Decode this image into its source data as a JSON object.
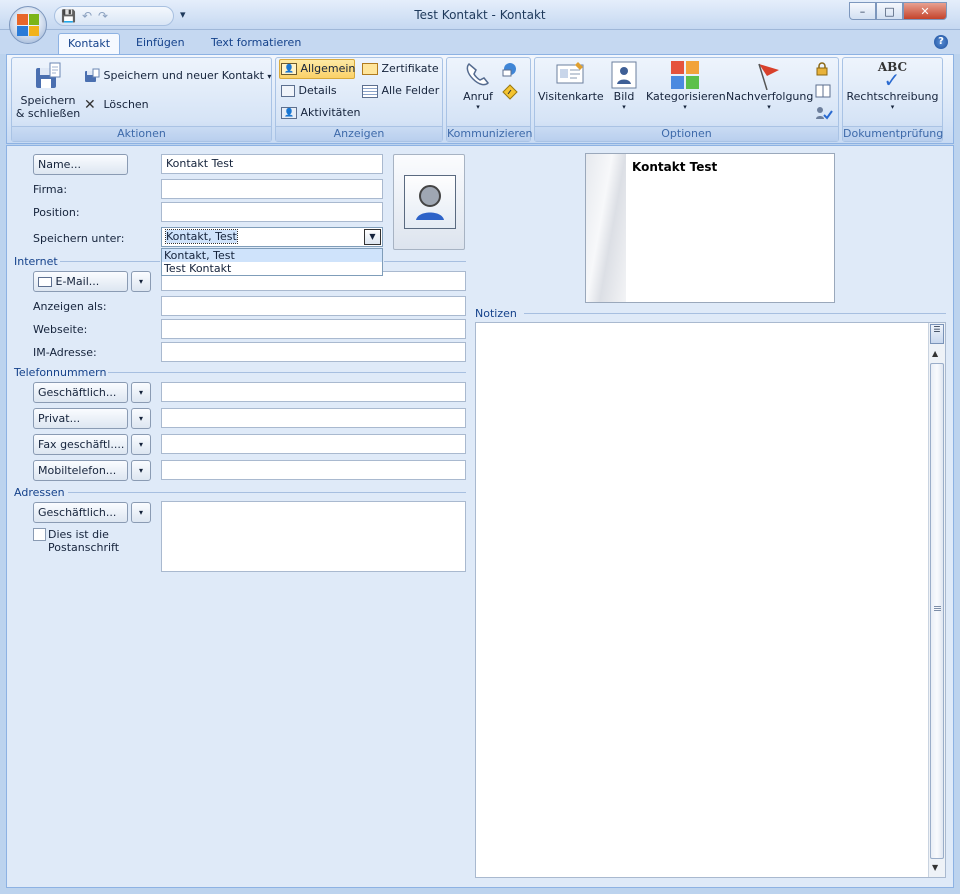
{
  "window": {
    "title": "Test Kontakt - Kontakt"
  },
  "tabs": [
    {
      "label": "Kontakt",
      "active": true
    },
    {
      "label": "Einfügen",
      "active": false
    },
    {
      "label": "Text formatieren",
      "active": false
    }
  ],
  "help_icon": "?",
  "ribbon": {
    "groups": {
      "aktionen": "Aktionen",
      "anzeigen": "Anzeigen",
      "kommunizieren": "Kommunizieren",
      "optionen": "Optionen",
      "dokumentpruefung": "Dokumentprüfung"
    },
    "aktionen": {
      "save_close_line1": "Speichern",
      "save_close_line2": "& schließen",
      "save_new": "Speichern und neuer Kontakt",
      "delete": "Löschen"
    },
    "anzeigen": {
      "allgemein": "Allgemein",
      "details": "Details",
      "aktivitaeten": "Aktivitäten",
      "zertifikate": "Zertifikate",
      "alle_felder": "Alle Felder"
    },
    "kommunizieren": {
      "anruf": "Anruf"
    },
    "optionen": {
      "visitenkarte": "Visitenkarte",
      "bild": "Bild",
      "kategorisieren": "Kategorisieren",
      "nachverfolgung": "Nachverfolgung"
    },
    "dokumentpruefung": {
      "rechtschreibung": "Rechtschreibung",
      "abc": "ABC"
    }
  },
  "form": {
    "name_button": "Name...",
    "name_value": "Kontakt Test",
    "firma_label": "Firma:",
    "firma_value": "",
    "position_label": "Position:",
    "position_value": "",
    "speichern_unter_label": "Speichern unter:",
    "speichern_unter_value": "Kontakt, Test",
    "speichern_unter_options": [
      "Kontakt, Test",
      "Test Kontakt"
    ],
    "internet_section": "Internet",
    "email_button": "E-Mail...",
    "email_value": "",
    "anzeigen_als_label": "Anzeigen als:",
    "webseite_label": "Webseite:",
    "im_label": "IM-Adresse:",
    "telefon_section": "Telefonnummern",
    "phone_buttons": [
      "Geschäftlich...",
      "Privat...",
      "Fax geschäftl....",
      "Mobiltelefon..."
    ],
    "adressen_section": "Adressen",
    "adresse_button": "Geschäftlich...",
    "postanschrift_line1": "Dies ist die",
    "postanschrift_line2": "Postanschrift",
    "postanschrift_checked": false,
    "notizen_section": "Notizen"
  },
  "business_card": {
    "name": "Kontakt Test"
  },
  "colors": {
    "accent": "#15428b",
    "ribbon_bg": "#d7e5f7",
    "highlight": "#fbd168"
  }
}
